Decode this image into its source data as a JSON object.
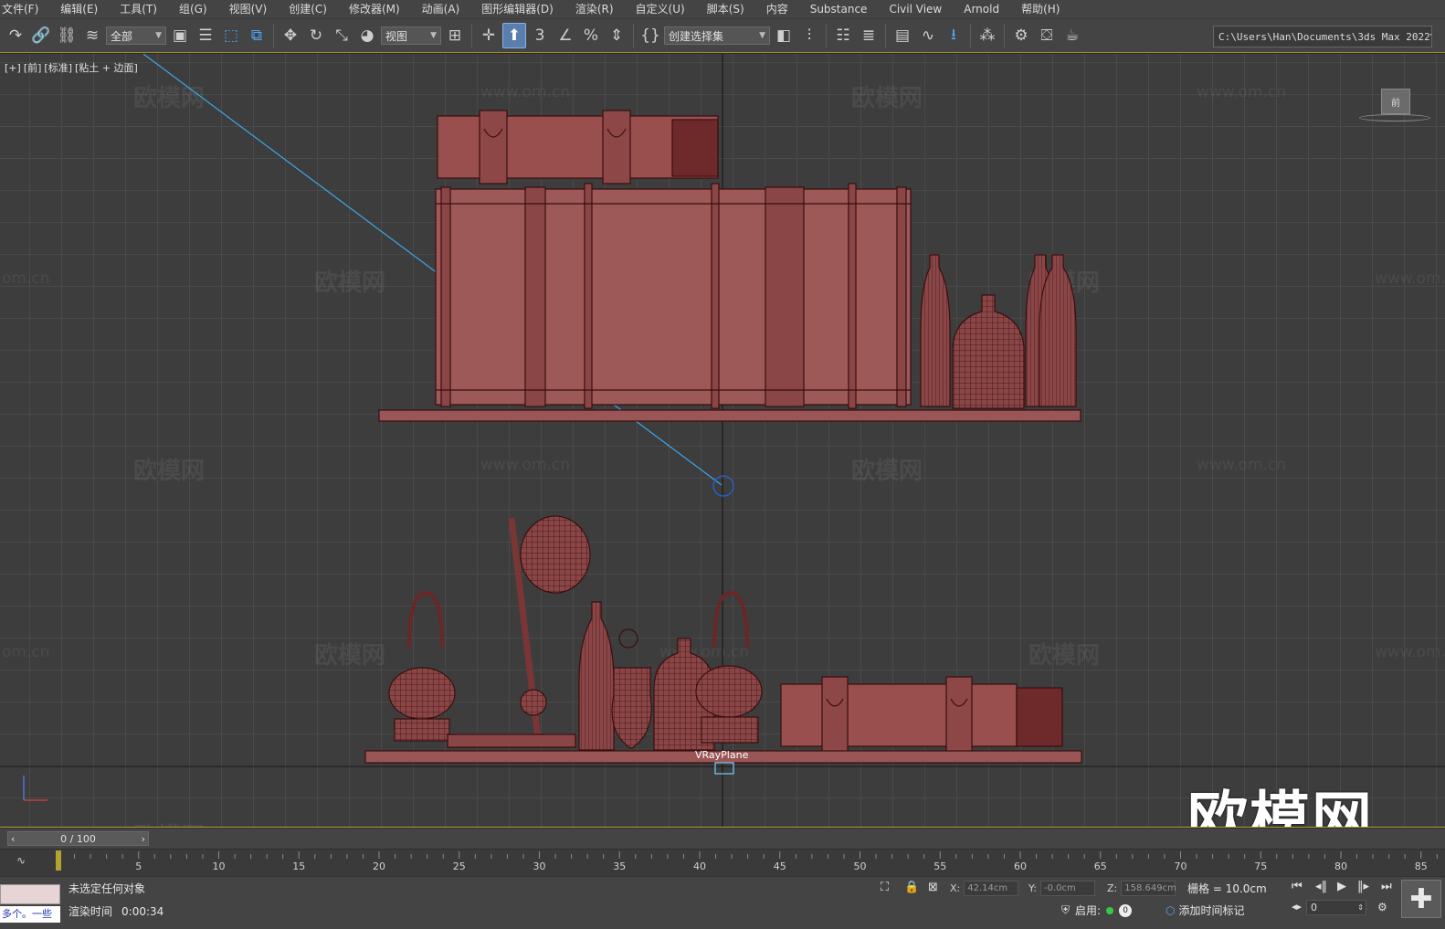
{
  "menu": [
    "文件(F)",
    "编辑(E)",
    "工具(T)",
    "组(G)",
    "视图(V)",
    "创建(C)",
    "修改器(M)",
    "动画(A)",
    "图形编辑器(D)",
    "渲染(R)",
    "自定义(U)",
    "脚本(S)",
    "内容",
    "Substance",
    "Civil View",
    "Arnold",
    "帮助(H)"
  ],
  "toolbar": {
    "filter_value": "全部",
    "ref_coord_value": "视图",
    "snap_3_label": "3",
    "selection_set_value": "创建选择集",
    "path": "C:\\Users\\Han\\Documents\\3ds Max 2022"
  },
  "viewport": {
    "labels": [
      "[+]",
      "[前]",
      "[标准]",
      "[粘土 + 边面]"
    ],
    "watermark_brand": "欧模网",
    "watermark_url": "www.om.cn",
    "watermark_url_short": "om.cn",
    "logo": "欧模网",
    "object_label": "VRayPlane",
    "viewcube_label": "前"
  },
  "timeline": {
    "slider_value": "0 / 100",
    "ticks": [
      "5",
      "10",
      "15",
      "20",
      "25",
      "30",
      "35",
      "40",
      "45",
      "50",
      "55",
      "60",
      "65",
      "70",
      "75",
      "80",
      "85"
    ],
    "current_frame": 0,
    "total_frames": 100
  },
  "status": {
    "message": "未选定任何对象",
    "render_time_label": "渲染时间",
    "render_time_value": "0:00:34",
    "thumb_text": "多个。一些",
    "x_label": "X:",
    "x_value": "42.14cm",
    "y_label": "Y:",
    "y_value": "-0.0cm",
    "z_label": "Z:",
    "z_value": "158.649cm",
    "grid": "栅格 = 10.0cm",
    "enable_label": "启用:",
    "zero_badge": "0",
    "add_time_tag": "添加时间标记",
    "frame_field": "0"
  },
  "colors": {
    "model_fill": "#8a4646",
    "model_stroke": "#3a0e0e",
    "accent_blue": "#4ea7ff",
    "timeline_accent": "#b3a132"
  }
}
